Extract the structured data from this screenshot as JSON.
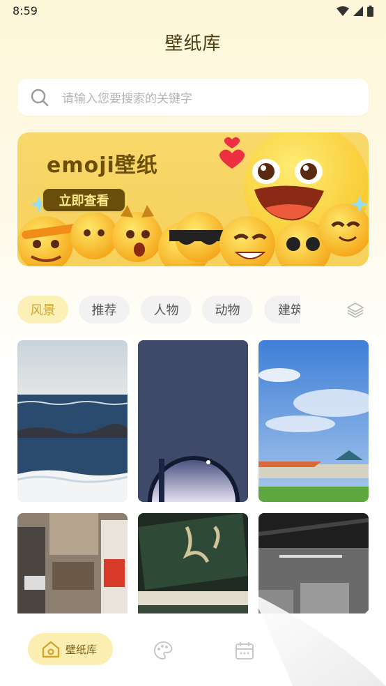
{
  "status": {
    "time": "8:59"
  },
  "header": {
    "title": "壁纸库"
  },
  "search": {
    "placeholder": "请输入您要搜索的关键字"
  },
  "banner": {
    "title": "emoji壁纸",
    "button_label": "立即查看"
  },
  "tabs": [
    {
      "label": "风景",
      "active": true
    },
    {
      "label": "推荐",
      "active": false
    },
    {
      "label": "人物",
      "active": false
    },
    {
      "label": "动物",
      "active": false
    },
    {
      "label": "建筑",
      "active": false
    }
  ],
  "wallpapers": [
    "ocean-waves-photo",
    "moon-through-window-photo",
    "blue-sky-building-photo",
    "city-street-photo",
    "stacked-books-photo",
    "warehouse-ceiling-photo"
  ],
  "bottom_nav": {
    "home_label": "壁纸库"
  },
  "colors": {
    "accent": "#fbeeb0",
    "active_text": "#d1a52c",
    "brand_dark": "#6b4e0c"
  }
}
